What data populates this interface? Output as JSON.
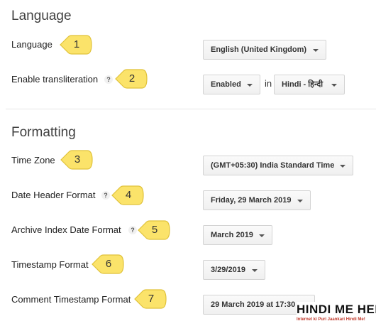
{
  "sections": {
    "language_heading": "Language",
    "formatting_heading": "Formatting"
  },
  "rows": {
    "language": {
      "label": "Language",
      "badge": "1",
      "value": "English (United Kingdom)"
    },
    "transliteration": {
      "label": "Enable transliteration",
      "help": "?",
      "badge": "2",
      "value": "Enabled",
      "in_text": "in",
      "language_value": "Hindi - हिन्दी"
    },
    "timezone": {
      "label": "Time Zone",
      "badge": "3",
      "value": "(GMT+05:30) India Standard Time"
    },
    "date_header": {
      "label": "Date Header Format",
      "help": "?",
      "badge": "4",
      "value": "Friday, 29 March 2019"
    },
    "archive_index": {
      "label": "Archive Index Date Format",
      "help": "?",
      "badge": "5",
      "value": "March 2019"
    },
    "timestamp": {
      "label": "Timestamp Format",
      "badge": "6",
      "value": "3/29/2019"
    },
    "comment_timestamp": {
      "label": "Comment Timestamp Format",
      "badge": "7",
      "value": "29 March 2019 at 17:30"
    }
  },
  "watermark": {
    "title": "HINDI ME HELP",
    "subtitle": "Internet ki Puri Jaankari Hindi Me!"
  },
  "colors": {
    "badge_fill": "#fbe36a",
    "badge_stroke": "#e0c23a",
    "accent_red": "#c0392b"
  }
}
